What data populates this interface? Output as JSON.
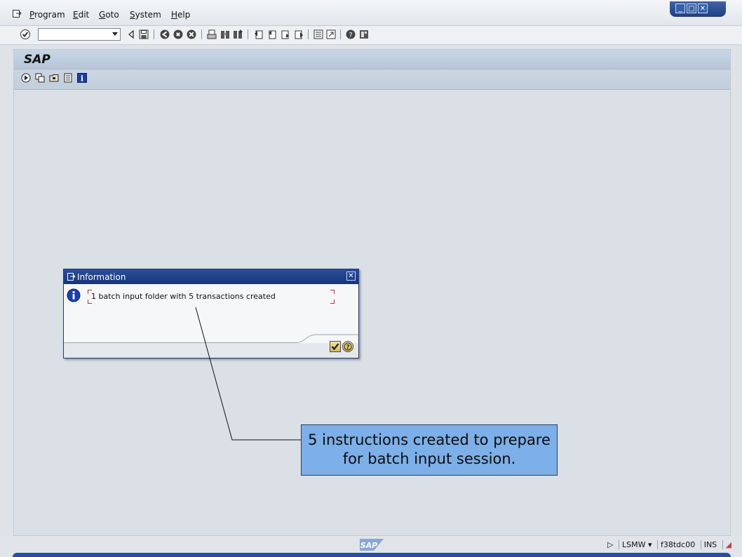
{
  "menubar": {
    "items": [
      {
        "key": "P",
        "rest": "rogram"
      },
      {
        "key": "E",
        "rest": "dit"
      },
      {
        "key": "G",
        "rest": "oto"
      },
      {
        "key": "S",
        "rest": "ystem"
      },
      {
        "key": "H",
        "rest": "elp"
      }
    ]
  },
  "toolbar": {
    "command_field": {
      "value": ""
    }
  },
  "screen": {
    "title": "SAP"
  },
  "dialog": {
    "title": "Information",
    "message": "1 batch input folder with 5 transactions created"
  },
  "callout": {
    "line1": "5 instructions created to prepare",
    "line2": "for batch input session."
  },
  "statusbar": {
    "logo_text": "SAP",
    "transaction": "LSMW",
    "server": "f38tdc00",
    "mode": "INS"
  },
  "colors": {
    "dialog_title": "#1f4188",
    "callout_bg": "#7dafe8",
    "screen_title_bar": "#c0cedd"
  }
}
